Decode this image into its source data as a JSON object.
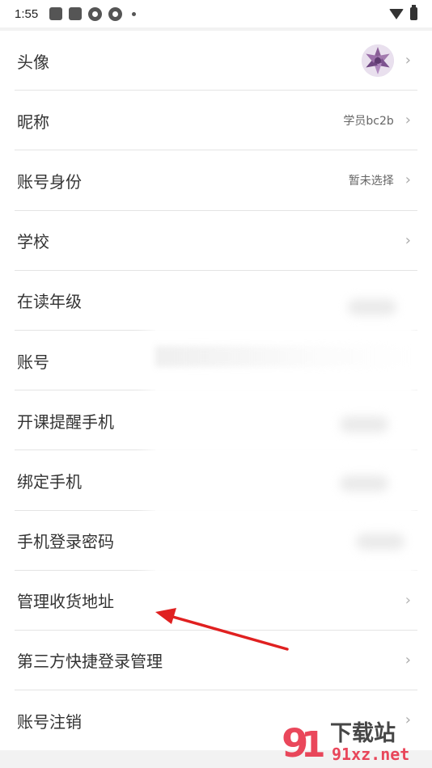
{
  "status_bar": {
    "time": "1:55",
    "icons": [
      "notification-square-icon",
      "notification-square-icon",
      "app-circle-icon",
      "app-circle-icon",
      "more-dot-icon",
      "wifi-icon",
      "battery-charging-icon"
    ]
  },
  "settings": {
    "rows": [
      {
        "label": "头像",
        "value": "",
        "has_avatar": true
      },
      {
        "label": "昵称",
        "value": "学员bc2b"
      },
      {
        "label": "账号身份",
        "value": "暂未选择"
      },
      {
        "label": "学校",
        "value": ""
      },
      {
        "label": "在读年级",
        "value": ""
      },
      {
        "label": "账号",
        "value": ""
      },
      {
        "label": "开课提醒手机",
        "value": ""
      },
      {
        "label": "绑定手机",
        "value": ""
      },
      {
        "label": "手机登录密码",
        "value": ""
      },
      {
        "label": "管理收货地址",
        "value": ""
      },
      {
        "label": "第三方快捷登录管理",
        "value": ""
      },
      {
        "label": "账号注销",
        "value": ""
      }
    ],
    "chevron": "›"
  },
  "annotation": {
    "arrow_color": "#e02020",
    "points_to": "管理收货地址"
  },
  "watermark": {
    "brand": "下载站",
    "site": "91xz.net",
    "color": "#e8344a"
  }
}
